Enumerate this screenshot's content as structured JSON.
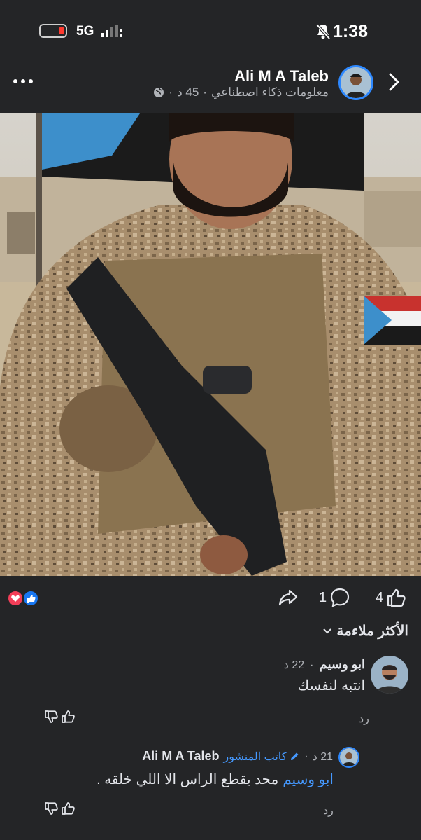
{
  "status_bar": {
    "time": "1:38",
    "network": "5G"
  },
  "post": {
    "author": "Ali M A Taleb",
    "subtitle": "معلومات ذكاء اصطناعي",
    "time": "45 د"
  },
  "actions": {
    "like_count": "4",
    "comment_count": "1"
  },
  "comments": {
    "sort_label": "الأكثر ملاءمة",
    "items": [
      {
        "author": "ابو وسيم",
        "time": "22 د",
        "text": "انتبه لنفسك",
        "reply_label": "رد"
      }
    ],
    "reply": {
      "author": "Ali M A Taleb",
      "badge": "كاتب المنشور",
      "time": "21 د",
      "mention": "ابو وسيم",
      "text": "محد يقطع الراس الا اللي خلقه .",
      "reply_label": "رد"
    }
  },
  "colors": {
    "background": "#242527",
    "accent": "#4599ff",
    "love": "#f33e58",
    "like": "#1877f2"
  }
}
